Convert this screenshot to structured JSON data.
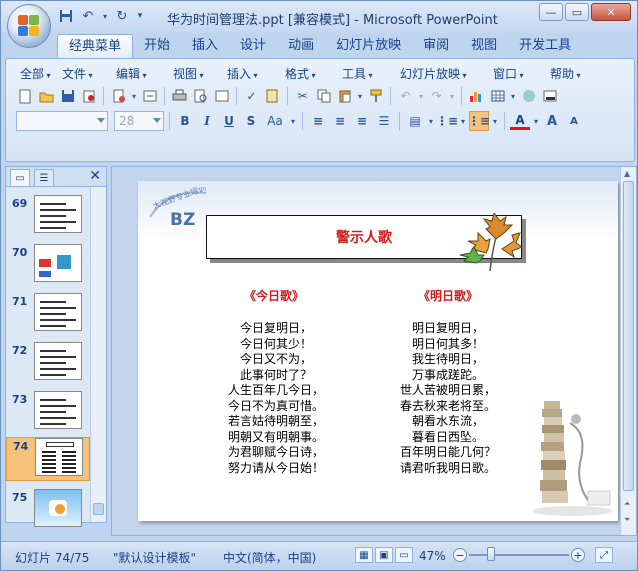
{
  "titlebar": {
    "title": "华为时间管理法.ppt [兼容模式] - Microsoft PowerPoint",
    "qat_icons": [
      "save-icon",
      "undo-icon",
      "redo-icon",
      "customize-icon"
    ]
  },
  "tabs": [
    {
      "label": "经典菜单",
      "active": true
    },
    {
      "label": "开始"
    },
    {
      "label": "插入"
    },
    {
      "label": "设计"
    },
    {
      "label": "动画"
    },
    {
      "label": "幻灯片放映"
    },
    {
      "label": "审阅"
    },
    {
      "label": "视图"
    },
    {
      "label": "开发工具"
    }
  ],
  "menu": [
    {
      "label": "全部"
    },
    {
      "label": "文件"
    },
    {
      "label": "编辑"
    },
    {
      "label": "视图"
    },
    {
      "label": "插入"
    },
    {
      "label": "格式"
    },
    {
      "label": "工具"
    },
    {
      "label": "幻灯片放映"
    },
    {
      "label": "窗口"
    },
    {
      "label": "帮助"
    }
  ],
  "format": {
    "font_name": "",
    "font_size": "28"
  },
  "left_pane": {
    "slides": [
      {
        "number": "69"
      },
      {
        "number": "70"
      },
      {
        "number": "71"
      },
      {
        "number": "72"
      },
      {
        "number": "73"
      },
      {
        "number": "74",
        "selected": true
      },
      {
        "number": "75"
      }
    ]
  },
  "slide": {
    "logo_text": "BZ",
    "logo_subtext": "大视野专业培训",
    "title": "警示人歌",
    "poem_left": {
      "title": "《今日歌》",
      "lines": [
        "今日复明日，",
        "今日何其少！",
        "今日又不为，",
        "此事何时了？",
        "人生百年几今日，",
        "今日不为真可惜。",
        "若言姑待明朝至，",
        "明朝又有明朝事。",
        "为君聊赋今日诗，",
        "努力请从今日始！"
      ]
    },
    "poem_right": {
      "title": "《明日歌》",
      "lines": [
        "明日复明日，",
        "明日何其多！",
        "我生待明日，",
        "万事成蹉跎。",
        "世人苦被明日累，",
        "春去秋来老将至。",
        "朝看水东流，",
        "暮看日西坠。",
        "百年明日能几何？",
        "请君听我明日歌。"
      ]
    }
  },
  "status": {
    "slide_info": "幻灯片 74/75",
    "template": "\"默认设计模板\"",
    "language": "中文(简体，中国)",
    "zoom": "47%"
  },
  "colors": {
    "accent_red": "#d21b1b",
    "ribbon_blue": "#15428b",
    "selection_orange": "#f6c27b"
  }
}
